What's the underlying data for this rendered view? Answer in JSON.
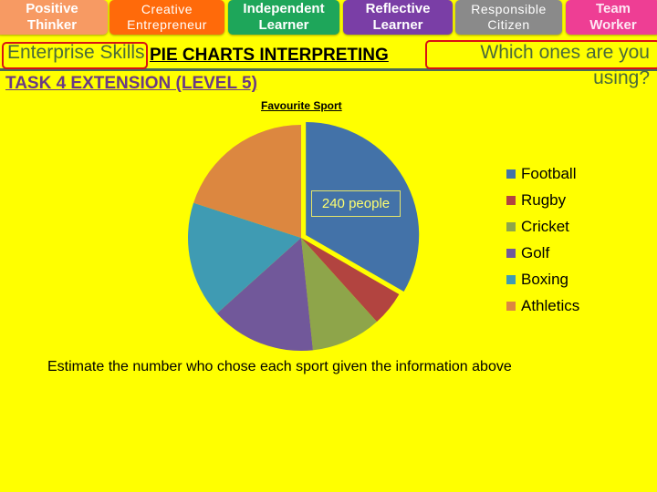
{
  "header": {
    "tabs": [
      {
        "label": "Positive\nThinker",
        "color": "#f79a63"
      },
      {
        "label": "Creative\nEntrepreneur",
        "color": "#ff6a0a"
      },
      {
        "label": "Independent\nLearner",
        "color": "#1ea65a"
      },
      {
        "label": "Reflective\nLearner",
        "color": "#7a3ea6"
      },
      {
        "label": "Responsible\nCitizen",
        "color": "#8a8a8a"
      },
      {
        "label": "Team\nWorker",
        "color": "#ee3e94"
      }
    ],
    "enterprise_label": "Enterprise Skills",
    "prompt": "Which ones are you using?"
  },
  "titles": {
    "main": "PIE CHARTS INTERPRETING",
    "sub": "TASK 4 EXTENSION (LEVEL 5)"
  },
  "instruction": "Estimate the number who chose each sport given the information above",
  "chart_data": {
    "type": "pie",
    "title": "Favourite Sport",
    "categories": [
      "Football",
      "Rugby",
      "Cricket",
      "Golf",
      "Boxing",
      "Athletics"
    ],
    "values": [
      240,
      36,
      72,
      108,
      120,
      144
    ],
    "colors": [
      "#4372a8",
      "#b24440",
      "#8ea54a",
      "#71589a",
      "#3f9bb3",
      "#dc8740"
    ],
    "start_angle_deg": 0,
    "direction": "clockwise",
    "exploded": [
      "Football"
    ],
    "annotation": {
      "category": "Football",
      "text": "240 people"
    },
    "legend_position": "right"
  }
}
